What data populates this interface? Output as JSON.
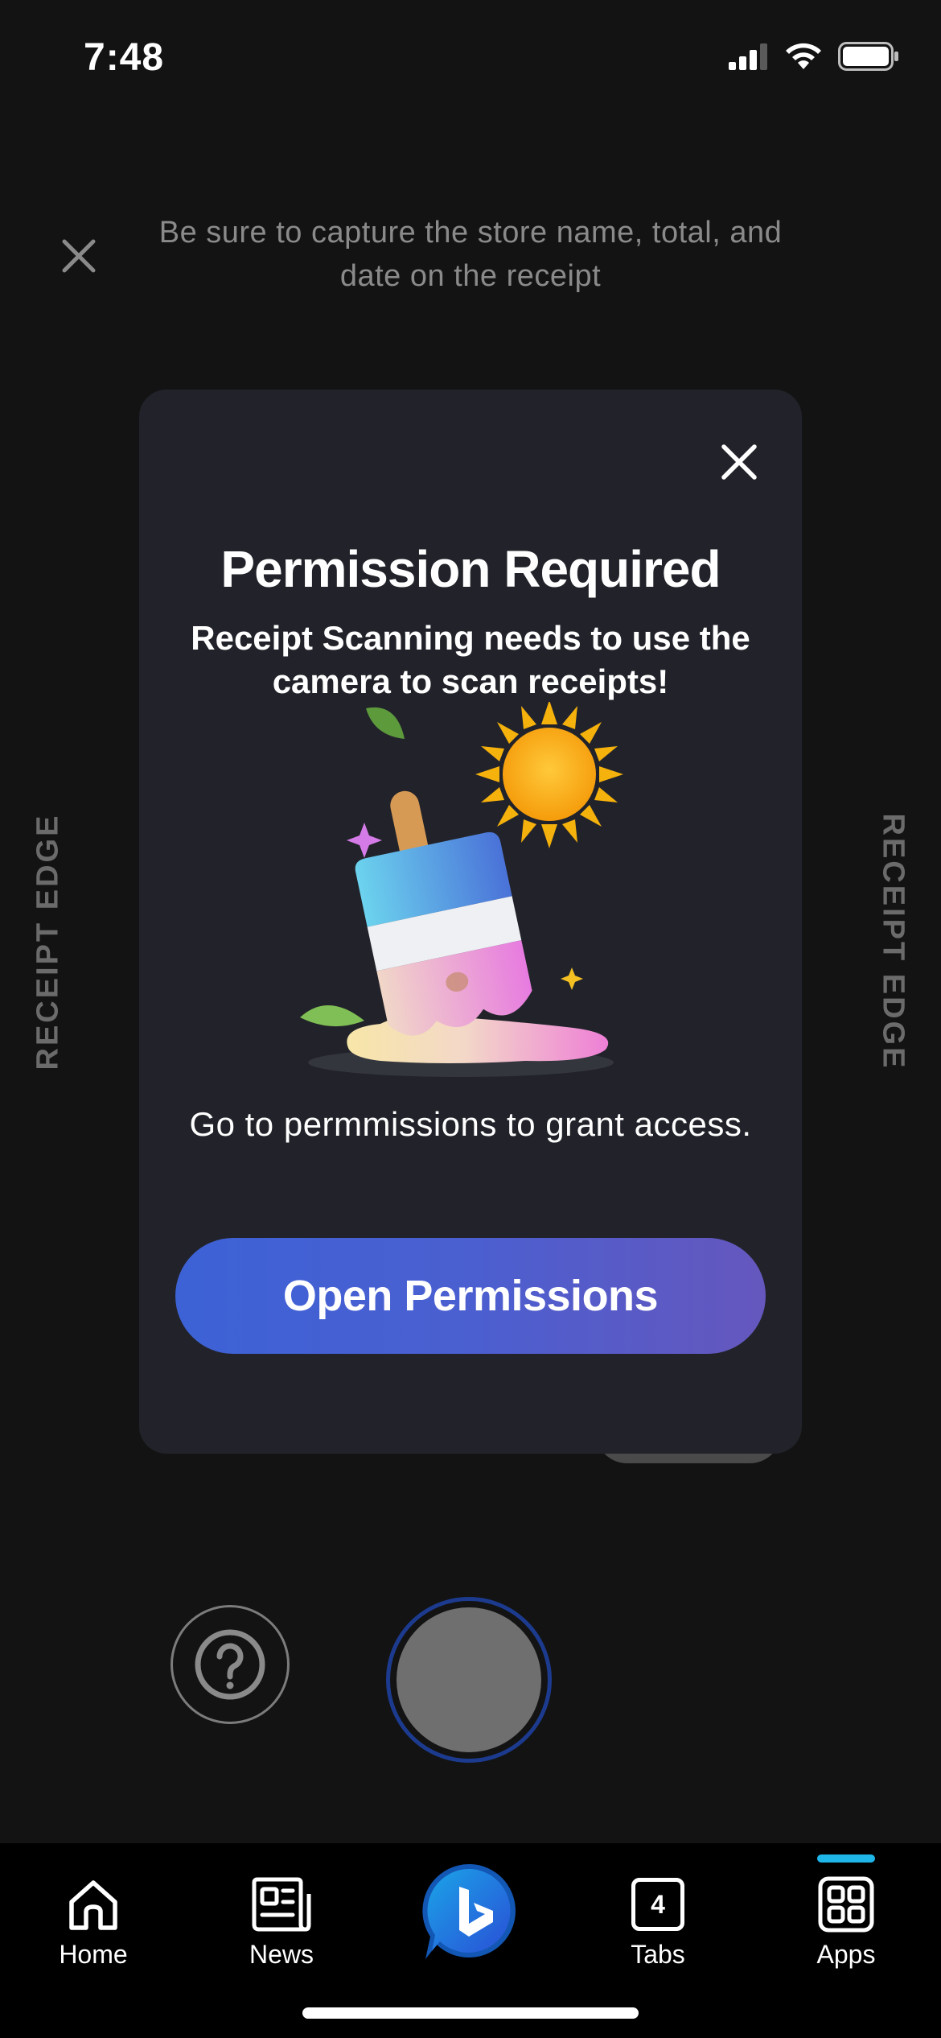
{
  "status_bar": {
    "time": "7:48",
    "icons": [
      "cellular-signal-icon",
      "wifi-icon",
      "battery-icon"
    ]
  },
  "camera": {
    "close_icon": "close-icon",
    "hint": "Be sure to capture the store name, total, and date on the receipt",
    "edge_left": "RECEIPT EDGE",
    "edge_right": "RECEIPT EDGE",
    "help_icon": "question-icon"
  },
  "dialog": {
    "close_icon": "close-icon",
    "title": "Permission Required",
    "subtitle": "Receipt Scanning needs to use the camera to scan receipts!",
    "illustration": "melting-popsicle-illustration",
    "body": "Go to permmissions to grant access.",
    "button_label": "Open Permissions"
  },
  "bottom_nav": {
    "items": [
      {
        "label": "Home",
        "icon": "home-icon"
      },
      {
        "label": "News",
        "icon": "news-icon"
      },
      {
        "label": "",
        "icon": "bing-chat-icon"
      },
      {
        "label": "Tabs",
        "icon": "tabs-icon",
        "count": "4"
      },
      {
        "label": "Apps",
        "icon": "apps-grid-icon"
      }
    ],
    "active": "Apps"
  },
  "colors": {
    "background": "#131313",
    "dialog_bg": "#22232a",
    "button_gradient_start": "#3c62d6",
    "button_gradient_end": "#6557be",
    "active_indicator": "#1fb6ea"
  }
}
